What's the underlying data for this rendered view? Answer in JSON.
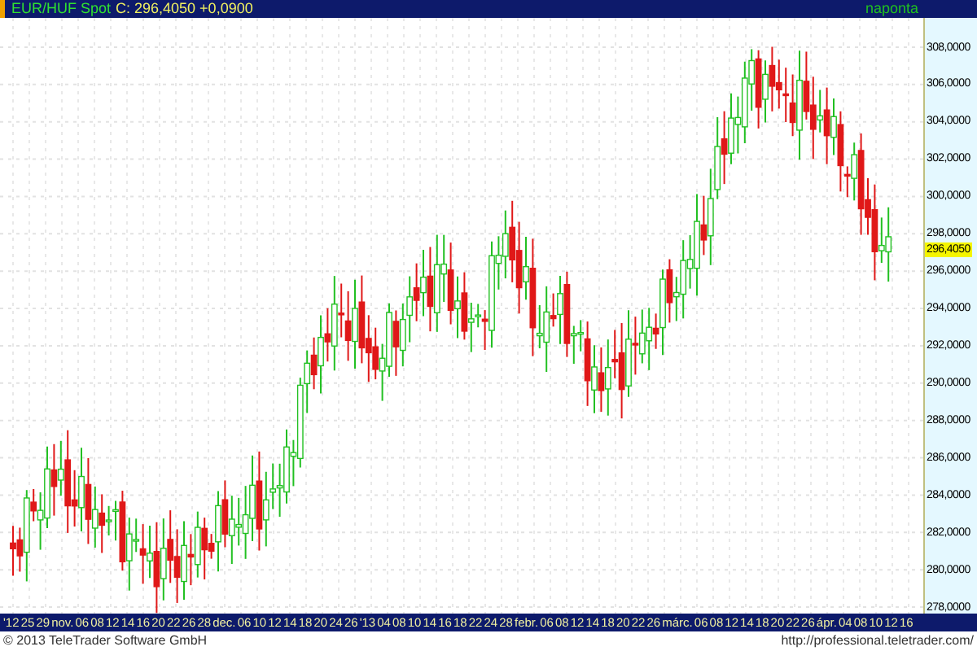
{
  "header": {
    "symbol": "EUR/HUF Spot",
    "quote": "C: 296,4050 +0,0900",
    "interval": "naponta"
  },
  "y_axis": {
    "ticks": [
      "308,0000",
      "306,0000",
      "304,0000",
      "302,0000",
      "300,0000",
      "298,0000",
      "296,0000",
      "294,0000",
      "292,0000",
      "290,0000",
      "288,0000",
      "286,0000",
      "284,0000",
      "282,0000",
      "280,0000",
      "278,0000"
    ],
    "last_price": "296,4050"
  },
  "x_axis": {
    "labels": [
      "'12",
      "25",
      "29",
      "nov.",
      "06",
      "08",
      "12",
      "14",
      "16",
      "20",
      "22",
      "26",
      "28",
      "dec.",
      "06",
      "10",
      "12",
      "14",
      "18",
      "20",
      "24",
      "26",
      "'13",
      "04",
      "08",
      "10",
      "14",
      "16",
      "18",
      "22",
      "24",
      "28",
      "febr.",
      "06",
      "08",
      "12",
      "14",
      "18",
      "20",
      "22",
      "26",
      "márc.",
      "06",
      "08",
      "12",
      "14",
      "18",
      "20",
      "22",
      "26",
      "ápr.",
      "04",
      "08",
      "10",
      "12",
      "16"
    ]
  },
  "footer": {
    "copyright": "© 2013 TeleTrader Software GmbH",
    "url": "http://professional.teletrader.com/"
  }
}
